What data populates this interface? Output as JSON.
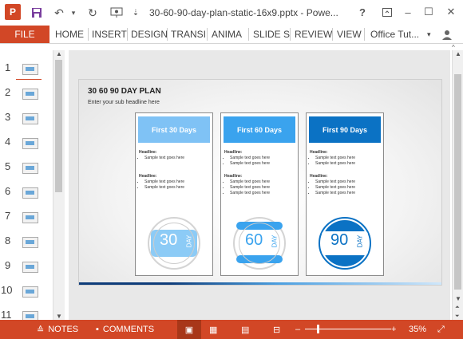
{
  "titlebar": {
    "app_logo": "P",
    "doc_title": "30-60-90-day-plan-static-16x9.pptx - Powe...",
    "icons": [
      "save-icon",
      "undo-icon",
      "redo-icon",
      "present-icon",
      "dropdown-icon"
    ],
    "help": "?",
    "minimize": "–",
    "restore": "☐",
    "close": "✕"
  },
  "ribbon": {
    "file": "FILE",
    "tabs": [
      "HOME",
      "INSERT",
      "DESIGN",
      "TRANSI",
      "ANIMA",
      "SLIDE S",
      "REVIEW",
      "VIEW"
    ],
    "account": "Office Tut..."
  },
  "thumbnails": [
    "1",
    "2",
    "3",
    "4",
    "5",
    "6",
    "7",
    "8",
    "9",
    "10",
    "11"
  ],
  "slide": {
    "title": "30 60 90 DAY PLAN",
    "subtitle": "Enter your sub headline here",
    "cards": [
      {
        "header": "First 30 Days",
        "color": "#7fc2f5",
        "headline1": "Headline:",
        "bullets1": [
          "Sample text goes here"
        ],
        "headline2": "Headline:",
        "bullets2": [
          "Sample text goes here",
          "Sample text goes here"
        ],
        "num": "30",
        "day": "DAY"
      },
      {
        "header": "First 60 Days",
        "color": "#3aa3ee",
        "headline1": "Headline:",
        "bullets1": [
          "Sample text goes here",
          "Sample text goes here"
        ],
        "headline2": "Headline:",
        "bullets2": [
          "Sample text goes here",
          "Sample text goes here",
          "Sample text goes here"
        ],
        "num": "60",
        "day": "DAY"
      },
      {
        "header": "First 90 Days",
        "color": "#0b72c4",
        "headline1": "Headline:",
        "bullets1": [
          "Sample text goes here",
          "Sample text goes here"
        ],
        "headline2": "Headline:",
        "bullets2": [
          "Sample text goes here",
          "Sample text goes here",
          "Sample text goes here"
        ],
        "num": "90",
        "day": "DAY"
      }
    ]
  },
  "statusbar": {
    "notes": "NOTES",
    "comments": "COMMENTS",
    "zoom_minus": "–",
    "zoom_plus": "+",
    "zoom": "35%"
  },
  "colors": {
    "accent": "#d24726"
  }
}
